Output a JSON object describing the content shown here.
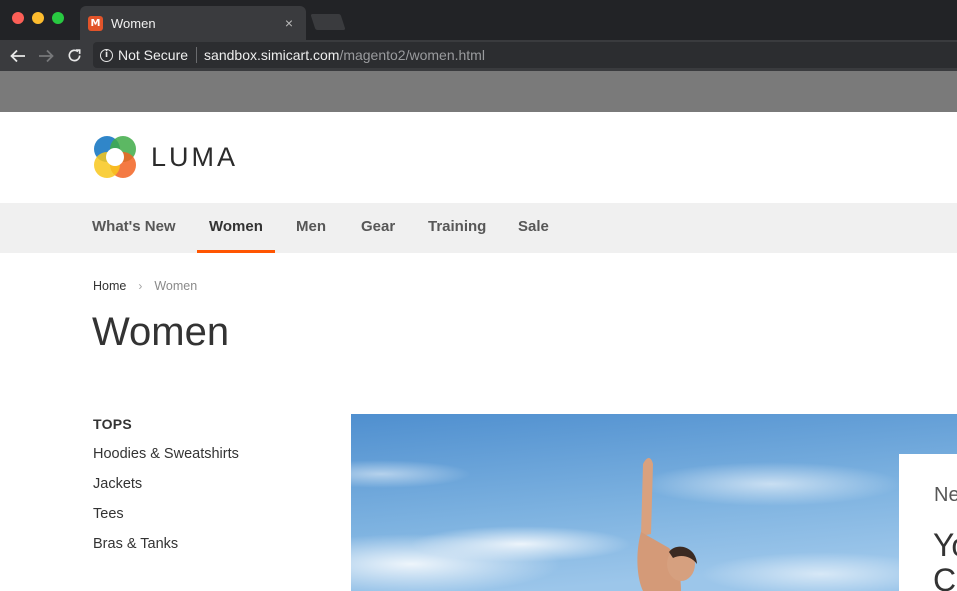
{
  "browser": {
    "tab": {
      "title": "Women",
      "favicon": "magento-icon",
      "close_glyph": "×"
    },
    "address": {
      "security_label": "Not Secure",
      "url_host": "sandbox.simicart.com",
      "url_path": "/magento2/women.html"
    }
  },
  "site": {
    "logo_text": "LUMA",
    "nav": [
      {
        "label": "What's New"
      },
      {
        "label": "Women",
        "active": true
      },
      {
        "label": "Men"
      },
      {
        "label": "Gear"
      },
      {
        "label": "Training"
      },
      {
        "label": "Sale"
      }
    ],
    "accent_color": "#ff5501"
  },
  "page": {
    "breadcrumb": {
      "home": "Home",
      "separator": "›",
      "current": "Women"
    },
    "title": "Women"
  },
  "sidebar": {
    "heading": "TOPS",
    "links": [
      "Hoodies & Sweatshirts",
      "Jackets",
      "Tees",
      "Bras & Tanks"
    ]
  },
  "promo": {
    "line1": "Ne",
    "line2": "Yo",
    "line3": "C"
  }
}
